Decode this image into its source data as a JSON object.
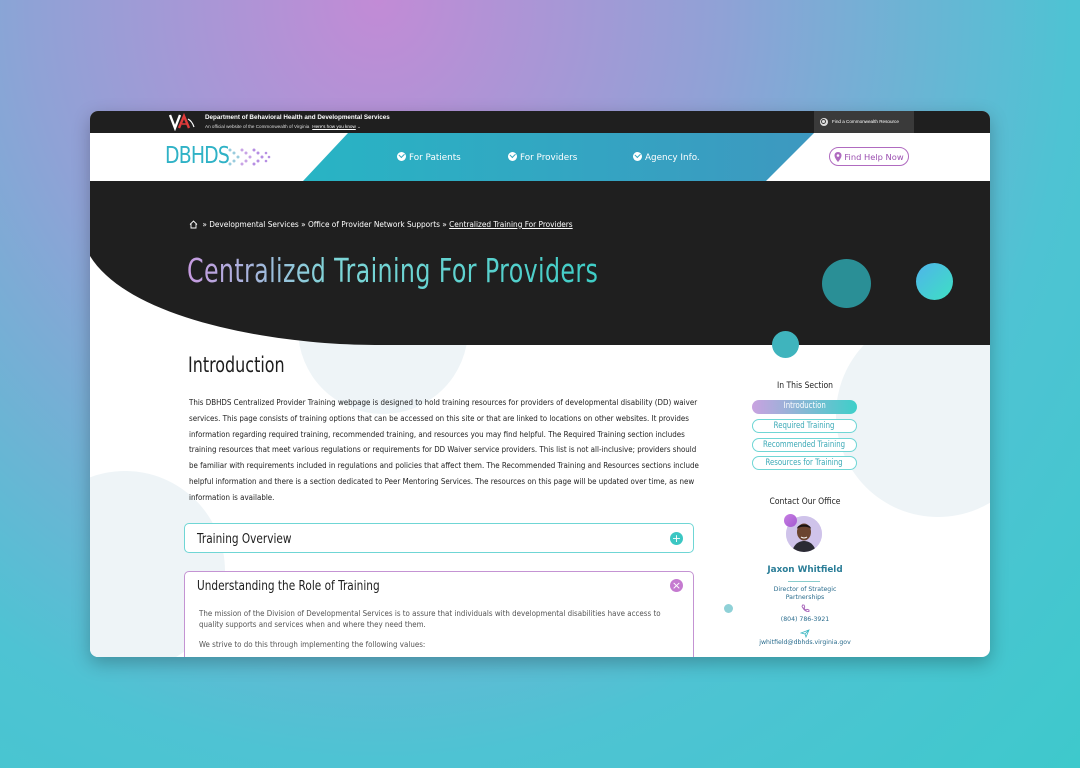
{
  "gov_bar": {
    "department": "Department of Behavioral Health and Developmental Services",
    "official_note": "An official website of the Commonwealth of Virginia",
    "how_you_know": "Here's how you know",
    "find_resource": "Find a Commonwealth Resource"
  },
  "nav": {
    "logo": "DBHDS",
    "items": [
      {
        "label": "For Patients"
      },
      {
        "label": "For Providers"
      },
      {
        "label": "Agency Info."
      }
    ],
    "find_help": "Find Help Now"
  },
  "breadcrumb": {
    "sep": "»",
    "items": [
      "Developmental Services",
      "Office of Provider Network Supports",
      "Centralized Training For Providers"
    ]
  },
  "page": {
    "title": "Centralized Training For Providers",
    "intro_heading": "Introduction",
    "intro_text": "This DBHDS Centralized Provider Training webpage is designed to hold training resources for providers of developmental disability (DD) waiver services. This page consists of training options that can be accessed on this site or that are linked to locations on other websites. It provides information regarding required training, recommended training, and resources you may find helpful. The Required Training section includes training resources that meet various regulations or requirements for DD Waiver service providers. This list is not all-inclusive; providers should be familiar with requirements included in regulations and policies that affect them. The Recommended Training and Resources sections include helpful information and there is a section dedicated to Peer Mentoring Services. The resources on this page will be updated over time, as new information is available."
  },
  "accordions": [
    {
      "title": "Training Overview",
      "icon": "plus-icon",
      "expanded": false
    },
    {
      "title": "Understanding the Role of Training",
      "icon": "close-icon",
      "expanded": true,
      "paragraphs": [
        "The mission of the Division of Developmental Services is to assure that individuals with developmental disabilities have access to quality supports and services when and where they need them.",
        "We strive to do this through implementing the following values:"
      ]
    }
  ],
  "sidebar": {
    "section_heading": "In This Section",
    "sections": [
      {
        "label": "Introduction",
        "active": true
      },
      {
        "label": "Required Training",
        "active": false
      },
      {
        "label": "Recommended Training",
        "active": false
      },
      {
        "label": "Resources for Training",
        "active": false
      }
    ],
    "contact_heading": "Contact Our Office",
    "contact": {
      "name": "Jaxon Whitfield",
      "role": "Director of Strategic Partnerships",
      "phone": "(804) 786-3921",
      "email": "jwhitfield@dbhds.virginia.gov"
    }
  },
  "colors": {
    "brand_teal": "#2fb2c6",
    "accent_purple": "#b06bc0",
    "hero_dark": "#1f1f1f"
  }
}
